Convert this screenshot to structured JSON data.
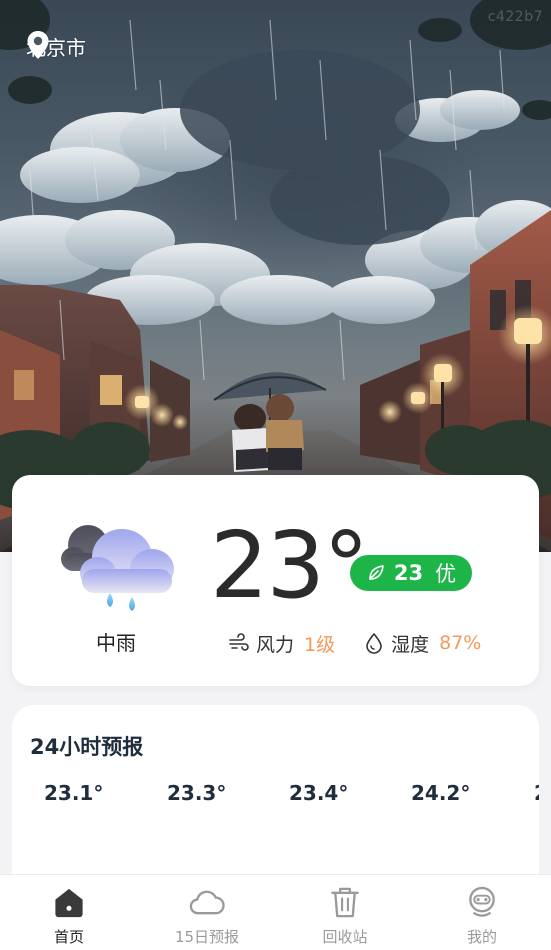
{
  "watermark": "c422b7",
  "location": {
    "icon": "location-pin-icon",
    "city": "北京市"
  },
  "current": {
    "condition": "中雨",
    "condition_icon": "rain-cloud-icon",
    "temperature": "23°",
    "aqi": {
      "value": "23",
      "level": "优",
      "color": "#1db548",
      "icon": "leaf-icon"
    },
    "wind": {
      "label": "风力",
      "value": "1级",
      "icon": "wind-icon"
    },
    "humidity": {
      "label": "湿度",
      "value": "87%",
      "icon": "water-drop-icon"
    },
    "accent_color": "#f29a5c"
  },
  "hourly": {
    "title": "24小时预报",
    "temps": [
      "23.1°",
      "23.3°",
      "23.4°",
      "24.2°",
      "2"
    ]
  },
  "tabs": [
    {
      "label": "首页",
      "icon": "home-icon",
      "active": true
    },
    {
      "label": "15日预报",
      "icon": "cloud-icon",
      "active": false
    },
    {
      "label": "回收站",
      "icon": "trash-icon",
      "active": false
    },
    {
      "label": "我的",
      "icon": "robot-face-icon",
      "active": false
    }
  ]
}
